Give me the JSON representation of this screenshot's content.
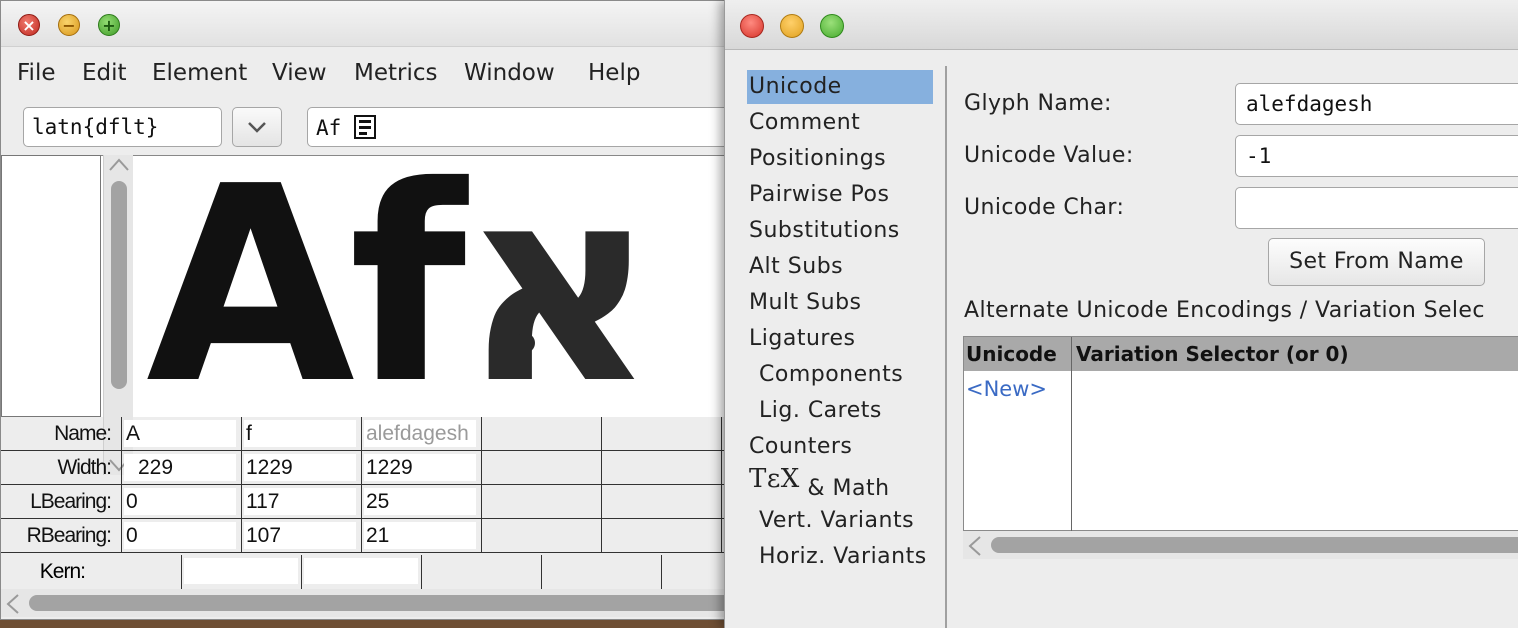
{
  "metrics_window": {
    "menu": {
      "file": "File",
      "edit": "Edit",
      "element": "Element",
      "view": "View",
      "metrics": "Metrics",
      "window": "Window",
      "help": "Help"
    },
    "script_value": "latn{dflt}",
    "text_value": "Af",
    "glyph_preview": {
      "latin": "Af",
      "hebrew": "א"
    },
    "rows": {
      "name_label": "Name:",
      "width_label": "Width:",
      "lbearing_label": "LBearing:",
      "rbearing_label": "RBearing:",
      "kern_label": "Kern:"
    },
    "columns": [
      {
        "name": "A",
        "width": "229",
        "lbearing": "0",
        "rbearing": "0"
      },
      {
        "name": "f",
        "width": "1229",
        "lbearing": "117",
        "rbearing": "107"
      },
      {
        "name": "alefdagesh",
        "width": "1229",
        "lbearing": "25",
        "rbearing": "21"
      }
    ]
  },
  "glyph_info_window": {
    "nav": [
      "Unicode",
      "Comment",
      "Positionings",
      "Pairwise Pos",
      "Substitutions",
      "Alt Subs",
      "Mult Subs",
      "Ligatures",
      "Components",
      "Lig. Carets",
      "Counters",
      "& Math",
      "Vert. Variants",
      "Horiz. Variants"
    ],
    "nav_tex_logo": "TεX",
    "selected_nav": "Unicode",
    "glyph_name_label": "Glyph Name:",
    "glyph_name_value": "alefdagesh",
    "unicode_value_label": "Unicode Value:",
    "unicode_value_value": "-1",
    "unicode_char_label": "Unicode Char:",
    "unicode_char_value": "",
    "set_from_name_button": "Set From Name",
    "alt_encodings_title": "Alternate Unicode Encodings / Variation Selec",
    "table_headers": {
      "unicode": "Unicode",
      "variation": "Variation Selector (or 0)"
    },
    "table_new_row": "<New>"
  }
}
